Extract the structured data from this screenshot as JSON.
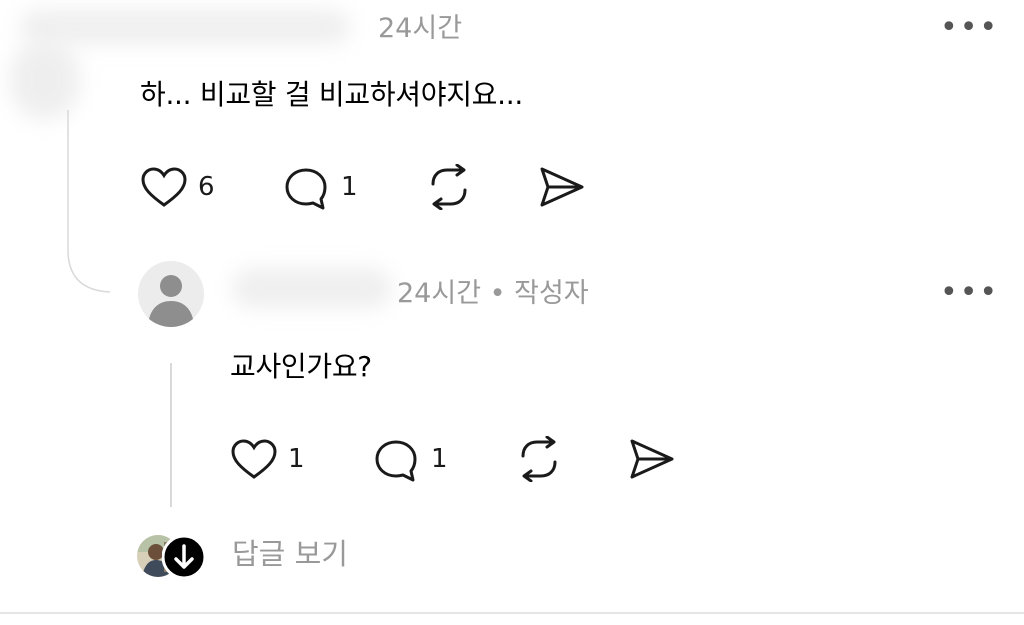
{
  "comment1": {
    "time": "24시간",
    "text": "하... 비교할 걸 비교하셔야지요...",
    "like_count": "6",
    "reply_count": "1",
    "icons": {
      "like": "heart-icon",
      "reply": "comment-bubble-icon",
      "repost": "repost-icon",
      "share": "send-icon",
      "more": "more-horizontal-icon"
    }
  },
  "comment2": {
    "time": "24시간 • 작성자",
    "text": "교사인가요?",
    "like_count": "1",
    "reply_count": "1",
    "icons": {
      "avatar": "default-avatar-icon",
      "like": "heart-icon",
      "reply": "comment-bubble-icon",
      "repost": "repost-icon",
      "share": "send-icon",
      "more": "more-horizontal-icon"
    }
  },
  "view_replies": {
    "label": "답글 보기",
    "icons": {
      "expand": "arrow-down-icon"
    }
  },
  "colors": {
    "text": "#000000",
    "muted": "#999999",
    "icon": "#1a1a1a",
    "line": "#d9d9d9"
  }
}
